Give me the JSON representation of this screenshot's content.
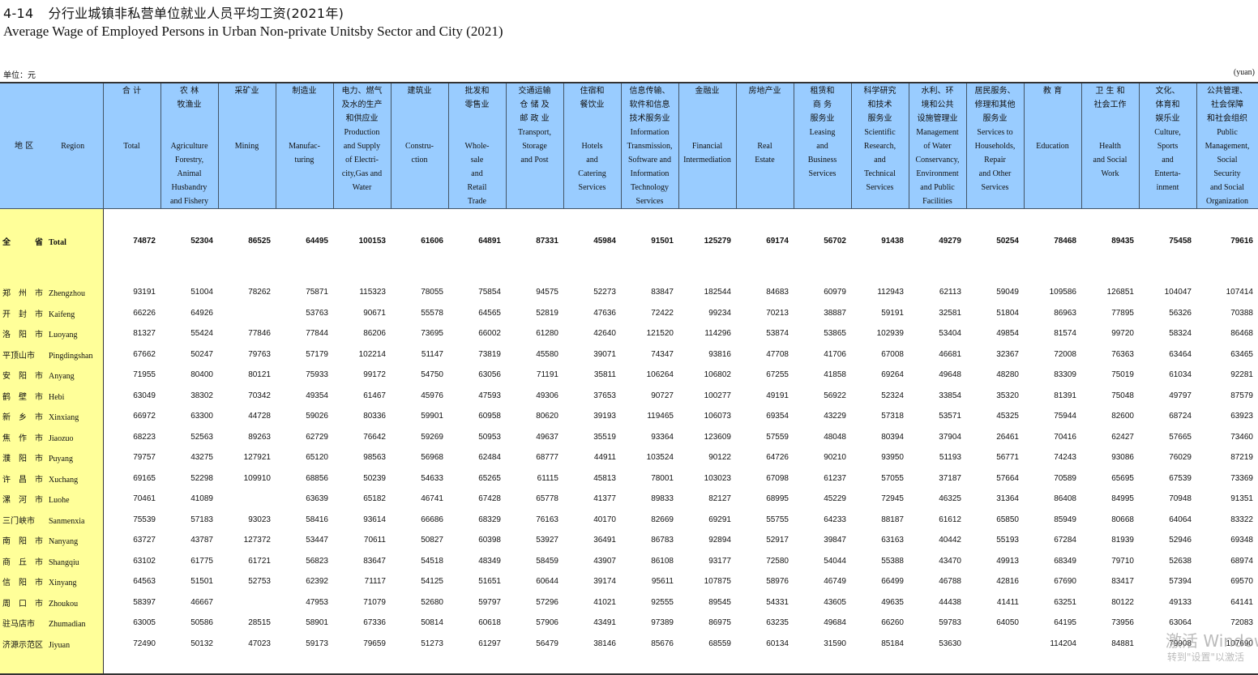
{
  "title": {
    "number": "4-14",
    "cn": "分行业城镇非私营单位就业人员平均工资(2021年)",
    "en": "Average Wage of Employed Persons in Urban Non-private Unitsby Sector and City (2021)"
  },
  "unit": {
    "cn": "单位：元",
    "en": "(yuan)"
  },
  "region_header": {
    "cn": "地 区",
    "en": "Region"
  },
  "columns": [
    {
      "cn": "合 计",
      "en": "\n\n\nTotal"
    },
    {
      "cn": "农 林\n牧渔业",
      "en": "\n\nAgriculture\nForestry,\nAnimal\nHusbandry\nand Fishery"
    },
    {
      "cn": "采矿业",
      "en": "\n\n\nMining"
    },
    {
      "cn": "制造业",
      "en": "\n\n\nManufac-\nturing"
    },
    {
      "cn": "电力、燃气\n及水的生产\n和供应业",
      "en": "Production\nand Supply\nof Electri-\ncity,Gas and\nWater"
    },
    {
      "cn": "建筑业",
      "en": "\n\n\nConstru-\nction"
    },
    {
      "cn": "批发和\n零售业",
      "en": "\n\nWhole-\nsale\nand\nRetail\nTrade"
    },
    {
      "cn": "交通运输\n仓 储 及\n邮 政 业",
      "en": "Transport,\nStorage\nand Post"
    },
    {
      "cn": "住宿和\n餐饮业",
      "en": "\n\nHotels\nand\nCatering\nServices"
    },
    {
      "cn": "信息传输、\n软件和信息\n技术服务业",
      "en": "Information\nTransmission,\nSoftware and\nInformation\nTechnology\nServices"
    },
    {
      "cn": "金融业",
      "en": "\n\n\nFinancial\nIntermediation"
    },
    {
      "cn": "房地产业",
      "en": "\n\n\nReal\nEstate"
    },
    {
      "cn": "租赁和\n商 务\n服务业",
      "en": "Leasing\nand\nBusiness\nServices"
    },
    {
      "cn": "科学研究\n和技术\n服务业",
      "en": "Scientific\nResearch,\nand\nTechnical\nServices"
    },
    {
      "cn": "水利、环\n境和公共\n设施管理业",
      "en": "Management\nof Water\nConservancy,\nEnvironment\nand Public\nFacilities"
    },
    {
      "cn": "居民服务、\n修理和其他\n服务业",
      "en": "Services to\nHouseholds,\nRepair\nand Other\nServices"
    },
    {
      "cn": "教 育",
      "en": "\n\n\nEducation"
    },
    {
      "cn": "卫 生 和\n社会工作",
      "en": "\n\nHealth\nand Social\nWork"
    },
    {
      "cn": "文化、\n体育和\n娱乐业",
      "en": "Culture,\nSports\nand\nEnterta-\ninment"
    },
    {
      "cn": "公共管理、\n社会保障\n和社会组织",
      "en": "Public\nManagement,\nSocial\nSecurity\nand Social\nOrganization"
    }
  ],
  "total_row": {
    "cn": "全　　　省",
    "en": "Total",
    "values": [
      "74872",
      "52304",
      "86525",
      "64495",
      "100153",
      "61606",
      "64891",
      "87331",
      "45984",
      "91501",
      "125279",
      "69174",
      "56702",
      "91438",
      "49279",
      "50254",
      "78468",
      "89435",
      "75458",
      "79616"
    ]
  },
  "rows": [
    {
      "cn": "郑　州　市",
      "en": "Zhengzhou",
      "values": [
        "93191",
        "51004",
        "78262",
        "75871",
        "115323",
        "78055",
        "75854",
        "94575",
        "52273",
        "83847",
        "182544",
        "84683",
        "60979",
        "112943",
        "62113",
        "59049",
        "109586",
        "126851",
        "104047",
        "107414"
      ]
    },
    {
      "cn": "开　封　市",
      "en": "Kaifeng",
      "values": [
        "66226",
        "64926",
        "",
        "53763",
        "90671",
        "55578",
        "64565",
        "52819",
        "47636",
        "72422",
        "99234",
        "70213",
        "38887",
        "59191",
        "32581",
        "51804",
        "86963",
        "77895",
        "56326",
        "70388"
      ]
    },
    {
      "cn": "洛　阳　市",
      "en": "Luoyang",
      "values": [
        "81327",
        "55424",
        "77846",
        "77844",
        "86206",
        "73695",
        "66002",
        "61280",
        "42640",
        "121520",
        "114296",
        "53874",
        "53865",
        "102939",
        "53404",
        "49854",
        "81574",
        "99720",
        "58324",
        "86468"
      ]
    },
    {
      "cn": "平顶山市",
      "en": "Pingdingshan",
      "values": [
        "67662",
        "50247",
        "79763",
        "57179",
        "102214",
        "51147",
        "73819",
        "45580",
        "39071",
        "74347",
        "93816",
        "47708",
        "41706",
        "67008",
        "46681",
        "32367",
        "72008",
        "76363",
        "63464",
        "63465"
      ]
    },
    {
      "cn": "安　阳　市",
      "en": "Anyang",
      "values": [
        "71955",
        "80400",
        "80121",
        "75933",
        "99172",
        "54750",
        "63056",
        "71191",
        "35811",
        "106264",
        "106802",
        "67255",
        "41858",
        "69264",
        "49648",
        "48280",
        "83309",
        "75019",
        "61034",
        "92281"
      ]
    },
    {
      "cn": "鹤　壁　市",
      "en": "Hebi",
      "values": [
        "63049",
        "38302",
        "70342",
        "49354",
        "61467",
        "45976",
        "47593",
        "49306",
        "37653",
        "90727",
        "100277",
        "49191",
        "56922",
        "52324",
        "33854",
        "35320",
        "81391",
        "75048",
        "49797",
        "87579"
      ]
    },
    {
      "cn": "新　乡　市",
      "en": "Xinxiang",
      "values": [
        "66972",
        "63300",
        "44728",
        "59026",
        "80336",
        "59901",
        "60958",
        "80620",
        "39193",
        "119465",
        "106073",
        "69354",
        "43229",
        "57318",
        "53571",
        "45325",
        "75944",
        "82600",
        "68724",
        "63923"
      ]
    },
    {
      "cn": "焦　作　市",
      "en": "Jiaozuo",
      "values": [
        "68223",
        "52563",
        "89263",
        "62729",
        "76642",
        "59269",
        "50953",
        "49637",
        "35519",
        "93364",
        "123609",
        "57559",
        "48048",
        "80394",
        "37904",
        "26461",
        "70416",
        "62427",
        "57665",
        "73460"
      ]
    },
    {
      "cn": "濮　阳　市",
      "en": "Puyang",
      "values": [
        "79757",
        "43275",
        "127921",
        "65120",
        "98563",
        "56968",
        "62484",
        "68777",
        "44911",
        "103524",
        "90122",
        "64726",
        "90210",
        "93950",
        "51193",
        "56771",
        "74243",
        "93086",
        "76029",
        "87219"
      ]
    },
    {
      "cn": "许　昌　市",
      "en": "Xuchang",
      "values": [
        "69165",
        "52298",
        "109910",
        "68856",
        "50239",
        "54633",
        "65265",
        "61115",
        "45813",
        "78001",
        "103023",
        "67098",
        "61237",
        "57055",
        "37187",
        "57664",
        "70589",
        "65695",
        "67539",
        "73369"
      ]
    },
    {
      "cn": "漯　河　市",
      "en": "Luohe",
      "values": [
        "70461",
        "41089",
        "",
        "63639",
        "65182",
        "46741",
        "67428",
        "65778",
        "41377",
        "89833",
        "82127",
        "68995",
        "45229",
        "72945",
        "46325",
        "31364",
        "86408",
        "84995",
        "70948",
        "91351"
      ]
    },
    {
      "cn": "三门峡市",
      "en": "Sanmenxia",
      "values": [
        "75539",
        "57183",
        "93023",
        "58416",
        "93614",
        "66686",
        "68329",
        "76163",
        "40170",
        "82669",
        "69291",
        "55755",
        "64233",
        "88187",
        "61612",
        "65850",
        "85949",
        "80668",
        "64064",
        "83322"
      ]
    },
    {
      "cn": "南　阳　市",
      "en": "Nanyang",
      "values": [
        "63727",
        "43787",
        "127372",
        "53447",
        "70611",
        "50827",
        "60398",
        "53927",
        "36491",
        "86783",
        "92894",
        "52917",
        "39847",
        "63163",
        "40442",
        "55193",
        "67284",
        "81939",
        "52946",
        "69348"
      ]
    },
    {
      "cn": "商　丘　市",
      "en": "Shangqiu",
      "values": [
        "63102",
        "61775",
        "61721",
        "56823",
        "83647",
        "54518",
        "48349",
        "58459",
        "43907",
        "86108",
        "93177",
        "72580",
        "54044",
        "55388",
        "43470",
        "49913",
        "68349",
        "79710",
        "52638",
        "68974"
      ]
    },
    {
      "cn": "信　阳　市",
      "en": "Xinyang",
      "values": [
        "64563",
        "51501",
        "52753",
        "62392",
        "71117",
        "54125",
        "51651",
        "60644",
        "39174",
        "95611",
        "107875",
        "58976",
        "46749",
        "66499",
        "46788",
        "42816",
        "67690",
        "83417",
        "57394",
        "69570"
      ]
    },
    {
      "cn": "周　口　市",
      "en": "Zhoukou",
      "values": [
        "58397",
        "46667",
        "",
        "47953",
        "71079",
        "52680",
        "59797",
        "57296",
        "41021",
        "92555",
        "89545",
        "54331",
        "43605",
        "49635",
        "44438",
        "41411",
        "63251",
        "80122",
        "49133",
        "64141"
      ]
    },
    {
      "cn": "驻马店市",
      "en": "Zhumadian",
      "values": [
        "63005",
        "50586",
        "28515",
        "58901",
        "67336",
        "50814",
        "60618",
        "57906",
        "43491",
        "97389",
        "86975",
        "63235",
        "49684",
        "66260",
        "59783",
        "64050",
        "64195",
        "73956",
        "63064",
        "72083"
      ]
    },
    {
      "cn": "济源示范区",
      "en": "Jiyuan",
      "values": [
        "72490",
        "50132",
        "47023",
        "59173",
        "79659",
        "51273",
        "61297",
        "56479",
        "38146",
        "85676",
        "68559",
        "60134",
        "31590",
        "85184",
        "53630",
        "",
        "114204",
        "84881",
        "79908",
        "107690"
      ]
    }
  ],
  "watermark": {
    "line1": "激活 Windows",
    "line2": "转到\"设置\"以激活"
  },
  "colors": {
    "header_bg": "#99ccff",
    "region_bg": "#ffff99"
  }
}
